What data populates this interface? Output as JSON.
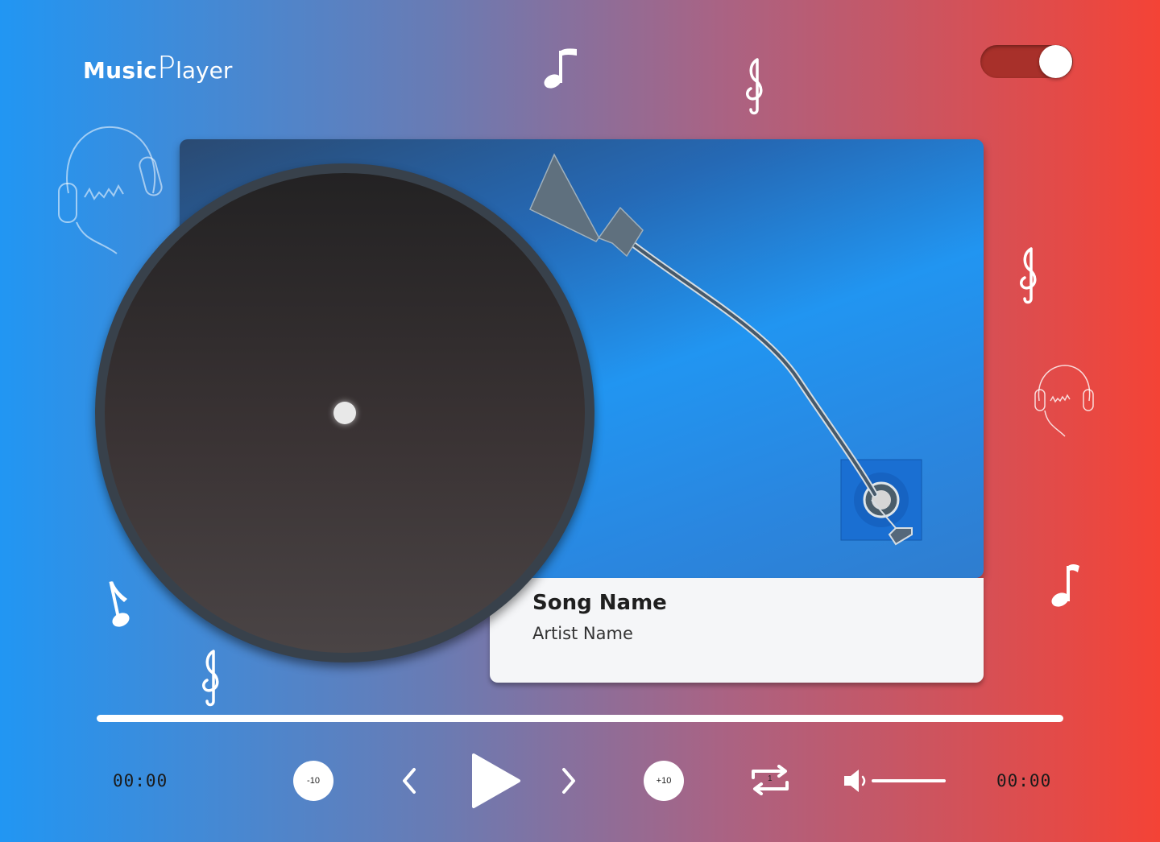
{
  "app": {
    "title_part1": "Music",
    "title_part2": "P",
    "title_part3": "layer"
  },
  "theme_toggle": {
    "state": "on"
  },
  "track": {
    "song_name": "Song Name",
    "artist_name": "Artist Name"
  },
  "playback": {
    "progress": 0,
    "current_time": "00:00",
    "total_time": "00:00"
  },
  "controls": {
    "rewind_label": "-10",
    "forward_label": "+10",
    "repeat_count": "1",
    "volume_level": 1.0
  },
  "icons": [
    "headphones-icon",
    "eighth-note-icon",
    "treble-clef-icon",
    "prev-icon",
    "play-icon",
    "next-icon",
    "repeat-icon",
    "volume-icon"
  ],
  "colors": {
    "gradient_start": "#2196f3",
    "gradient_end": "#f44336",
    "deck_blue": "#2195f1",
    "toggle_track": "#a8302a"
  }
}
